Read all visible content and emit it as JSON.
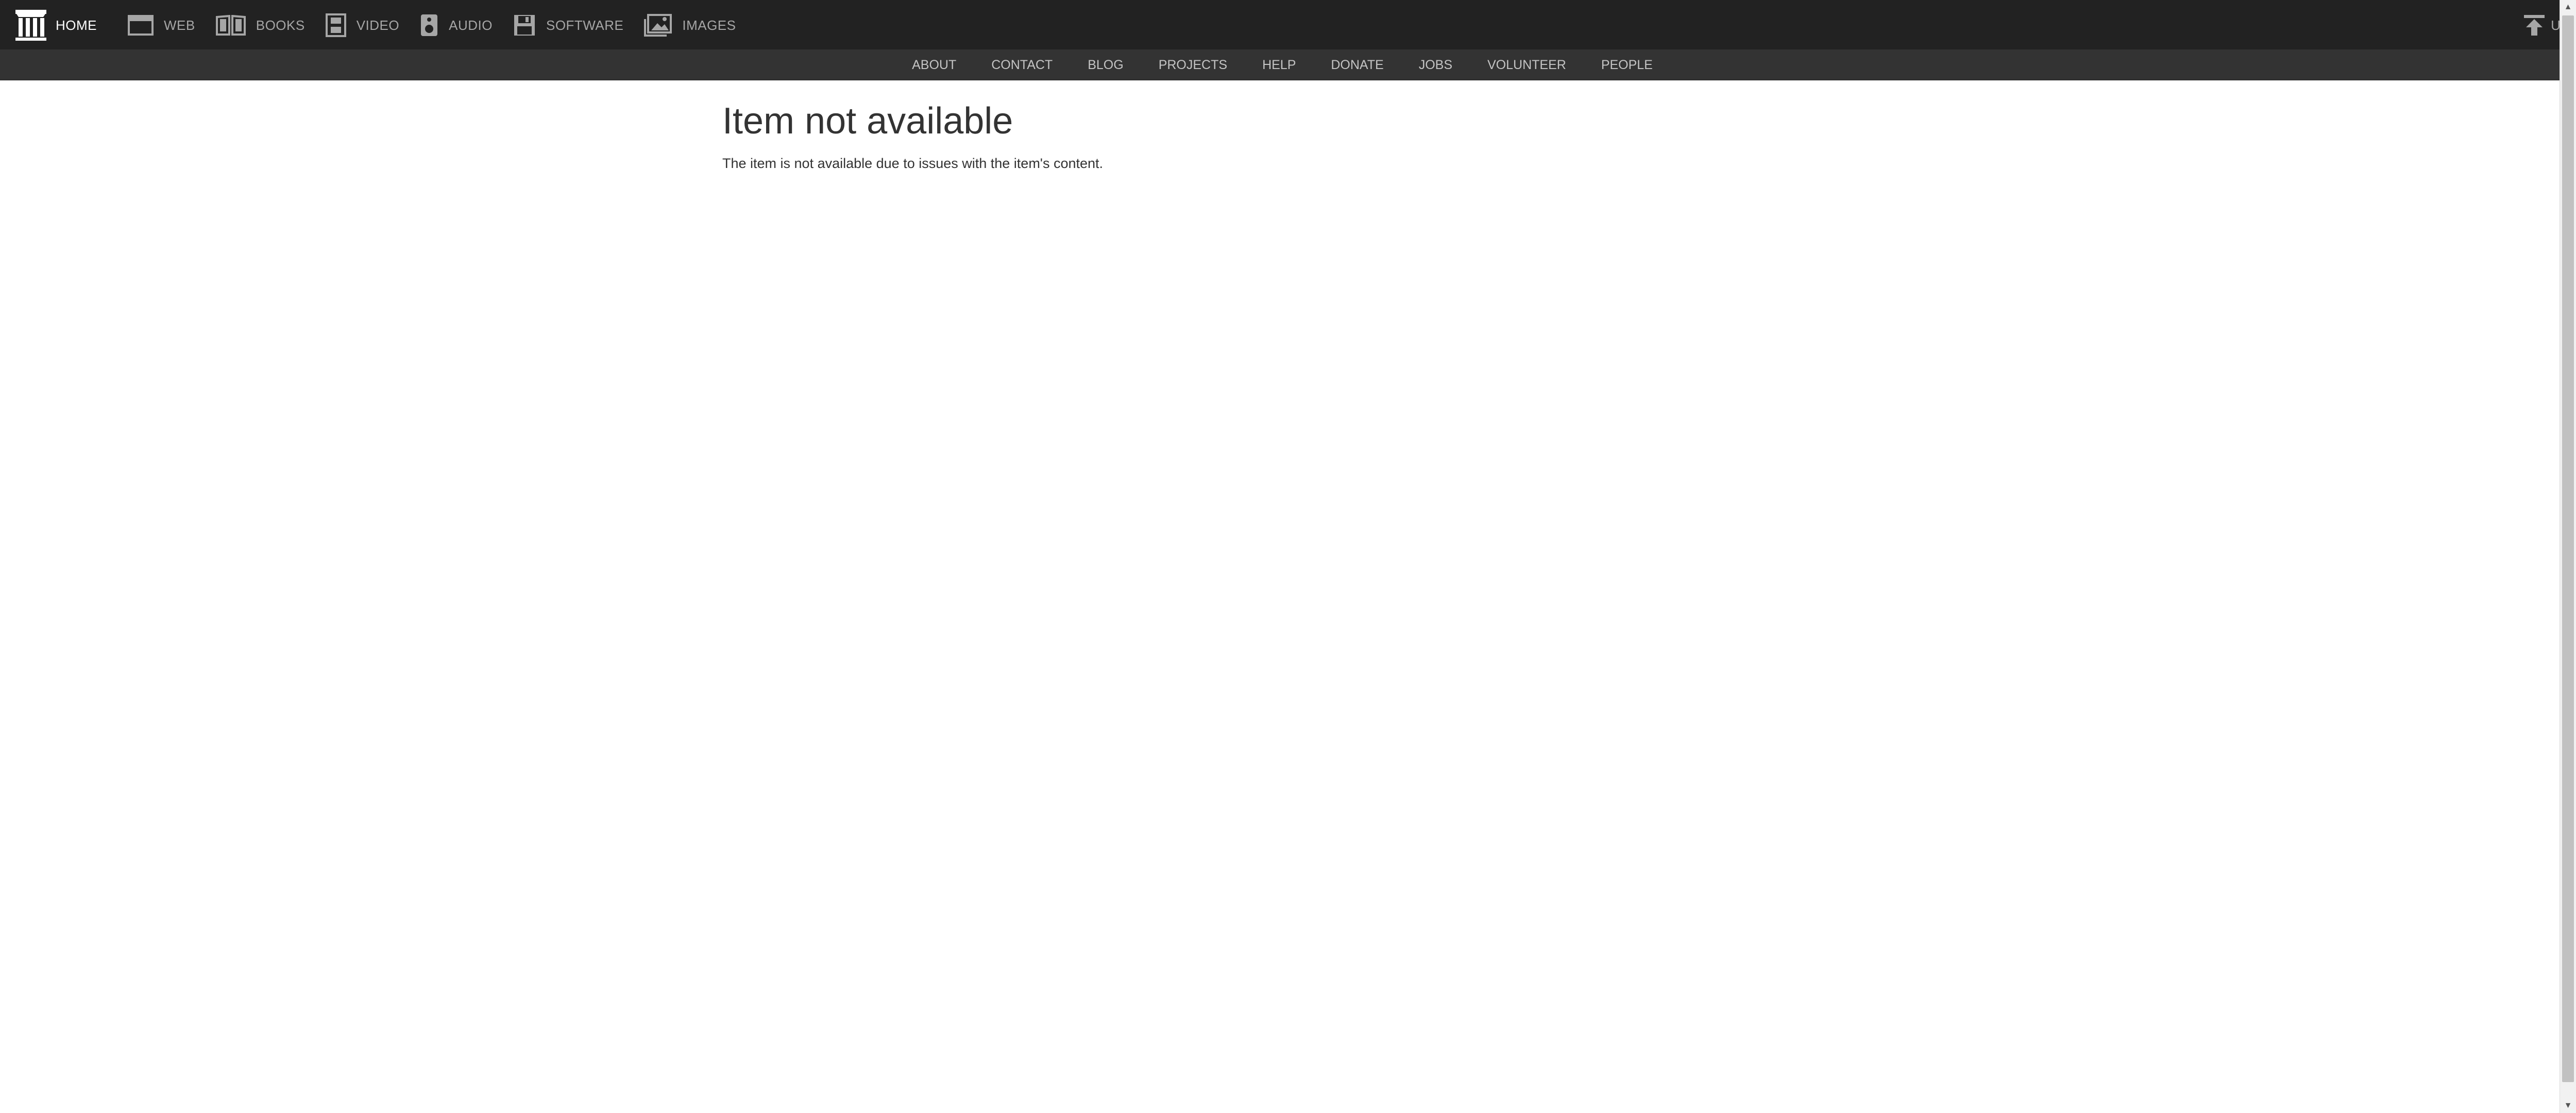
{
  "topnav": {
    "items": [
      {
        "label": "HOME",
        "icon": "archive-logo-icon"
      },
      {
        "label": "WEB",
        "icon": "web-icon"
      },
      {
        "label": "BOOKS",
        "icon": "book-icon"
      },
      {
        "label": "VIDEO",
        "icon": "film-icon"
      },
      {
        "label": "AUDIO",
        "icon": "speaker-icon"
      },
      {
        "label": "SOFTWARE",
        "icon": "floppy-disk-icon"
      },
      {
        "label": "IMAGES",
        "icon": "image-icon"
      }
    ],
    "upload_label": "UPLOAD",
    "upload_icon": "upload-icon"
  },
  "subnav": {
    "links": [
      "ABOUT",
      "CONTACT",
      "BLOG",
      "PROJECTS",
      "HELP",
      "DONATE",
      "JOBS",
      "VOLUNTEER",
      "PEOPLE"
    ]
  },
  "main": {
    "title": "Item not available",
    "message": "The item is not available due to issues with the item's content."
  },
  "colors": {
    "nav_bg": "#222222",
    "subnav_bg": "#333333",
    "nav_text": "#a6a6a6",
    "active_text": "#ffffff",
    "body_text": "#333333"
  }
}
